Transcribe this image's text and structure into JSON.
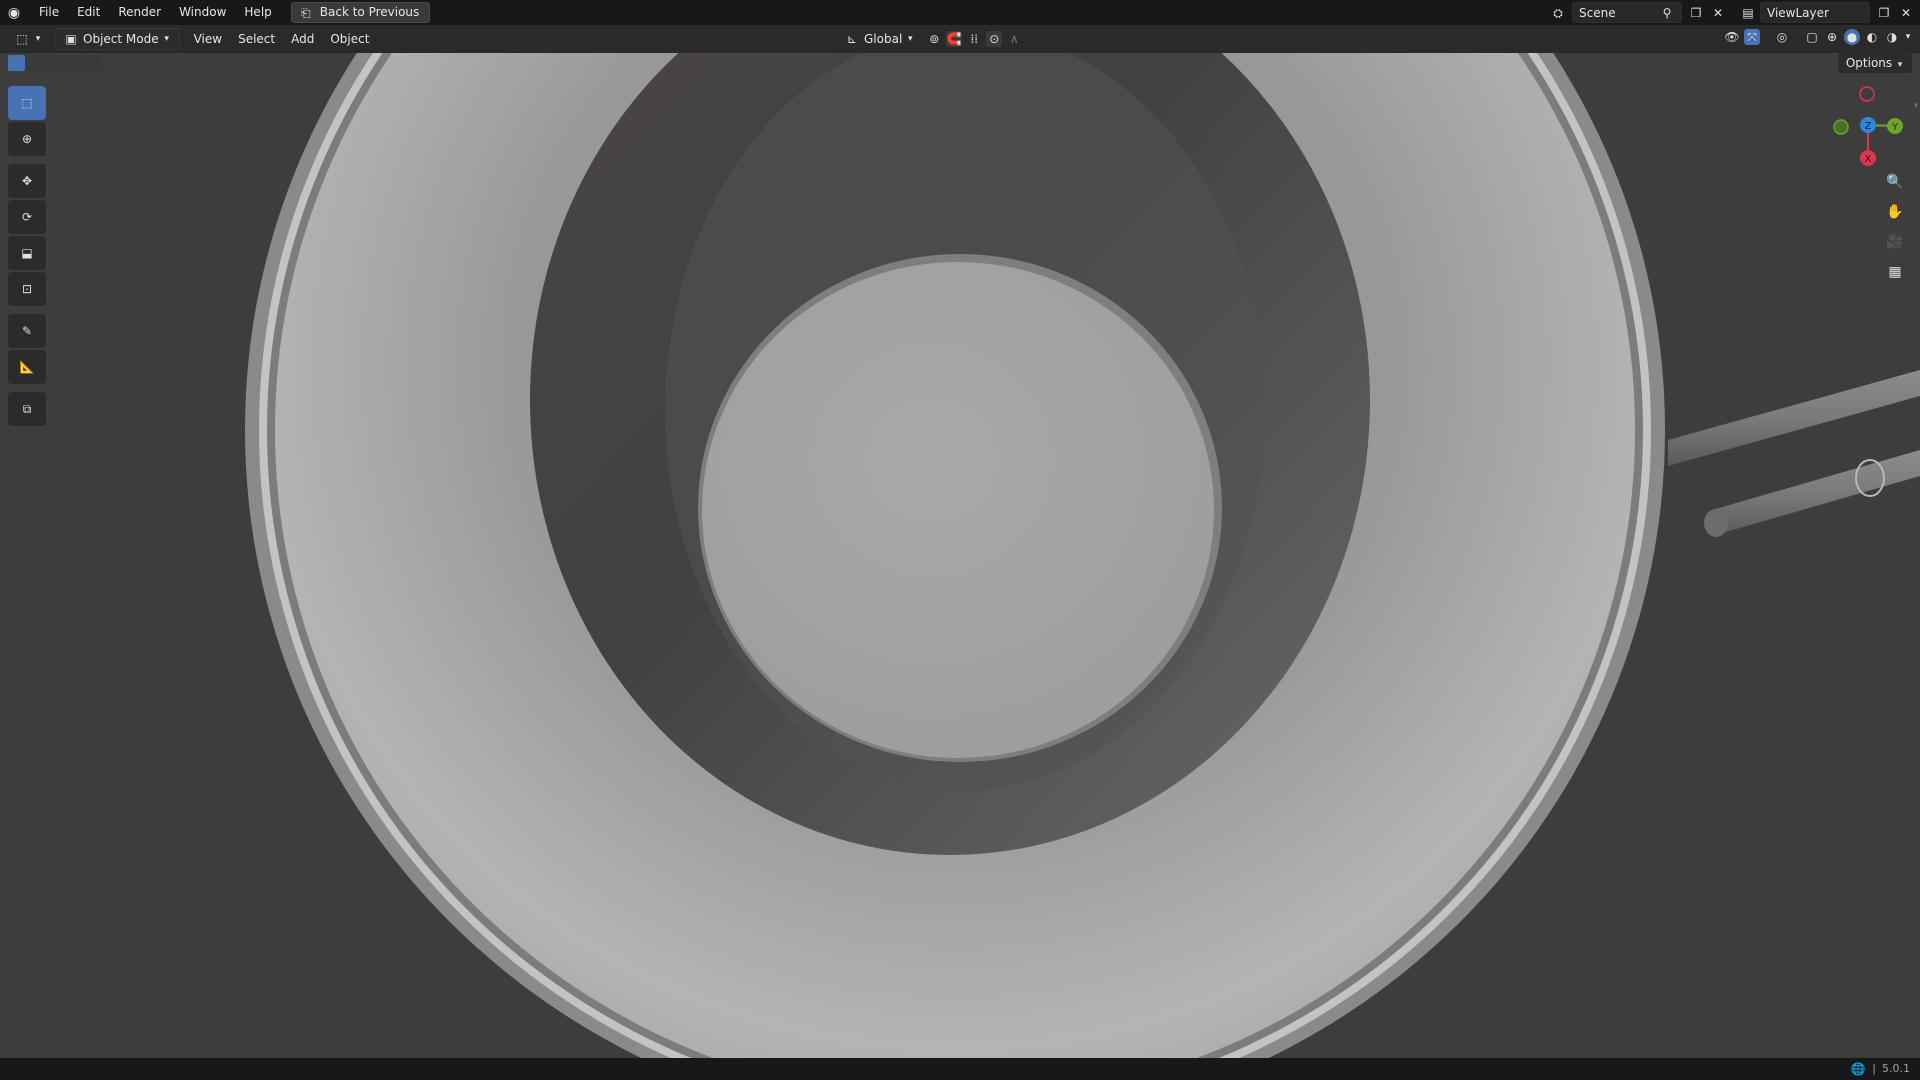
{
  "topbar": {
    "menus": [
      "File",
      "Edit",
      "Render",
      "Window",
      "Help"
    ],
    "back_button": "Back to Previous",
    "scene": "Scene",
    "view_layer": "ViewLayer"
  },
  "viewport_header": {
    "mode": "Object Mode",
    "menus": [
      "View",
      "Select",
      "Add",
      "Object"
    ],
    "transform_orientation": "Global"
  },
  "options_label": "Options",
  "gizmo": {
    "z": "Z",
    "y": "Y",
    "x": "X"
  },
  "tools": [
    "select-box",
    "cursor",
    "move",
    "rotate",
    "scale",
    "transform",
    "annotate",
    "measure",
    "add-cube"
  ],
  "statusbar": {
    "version": "5.0.1"
  },
  "colors": {
    "accent": "#4772b3",
    "axis_x": "#e0354f",
    "axis_y": "#6ea52a",
    "axis_z": "#2f86e0"
  }
}
